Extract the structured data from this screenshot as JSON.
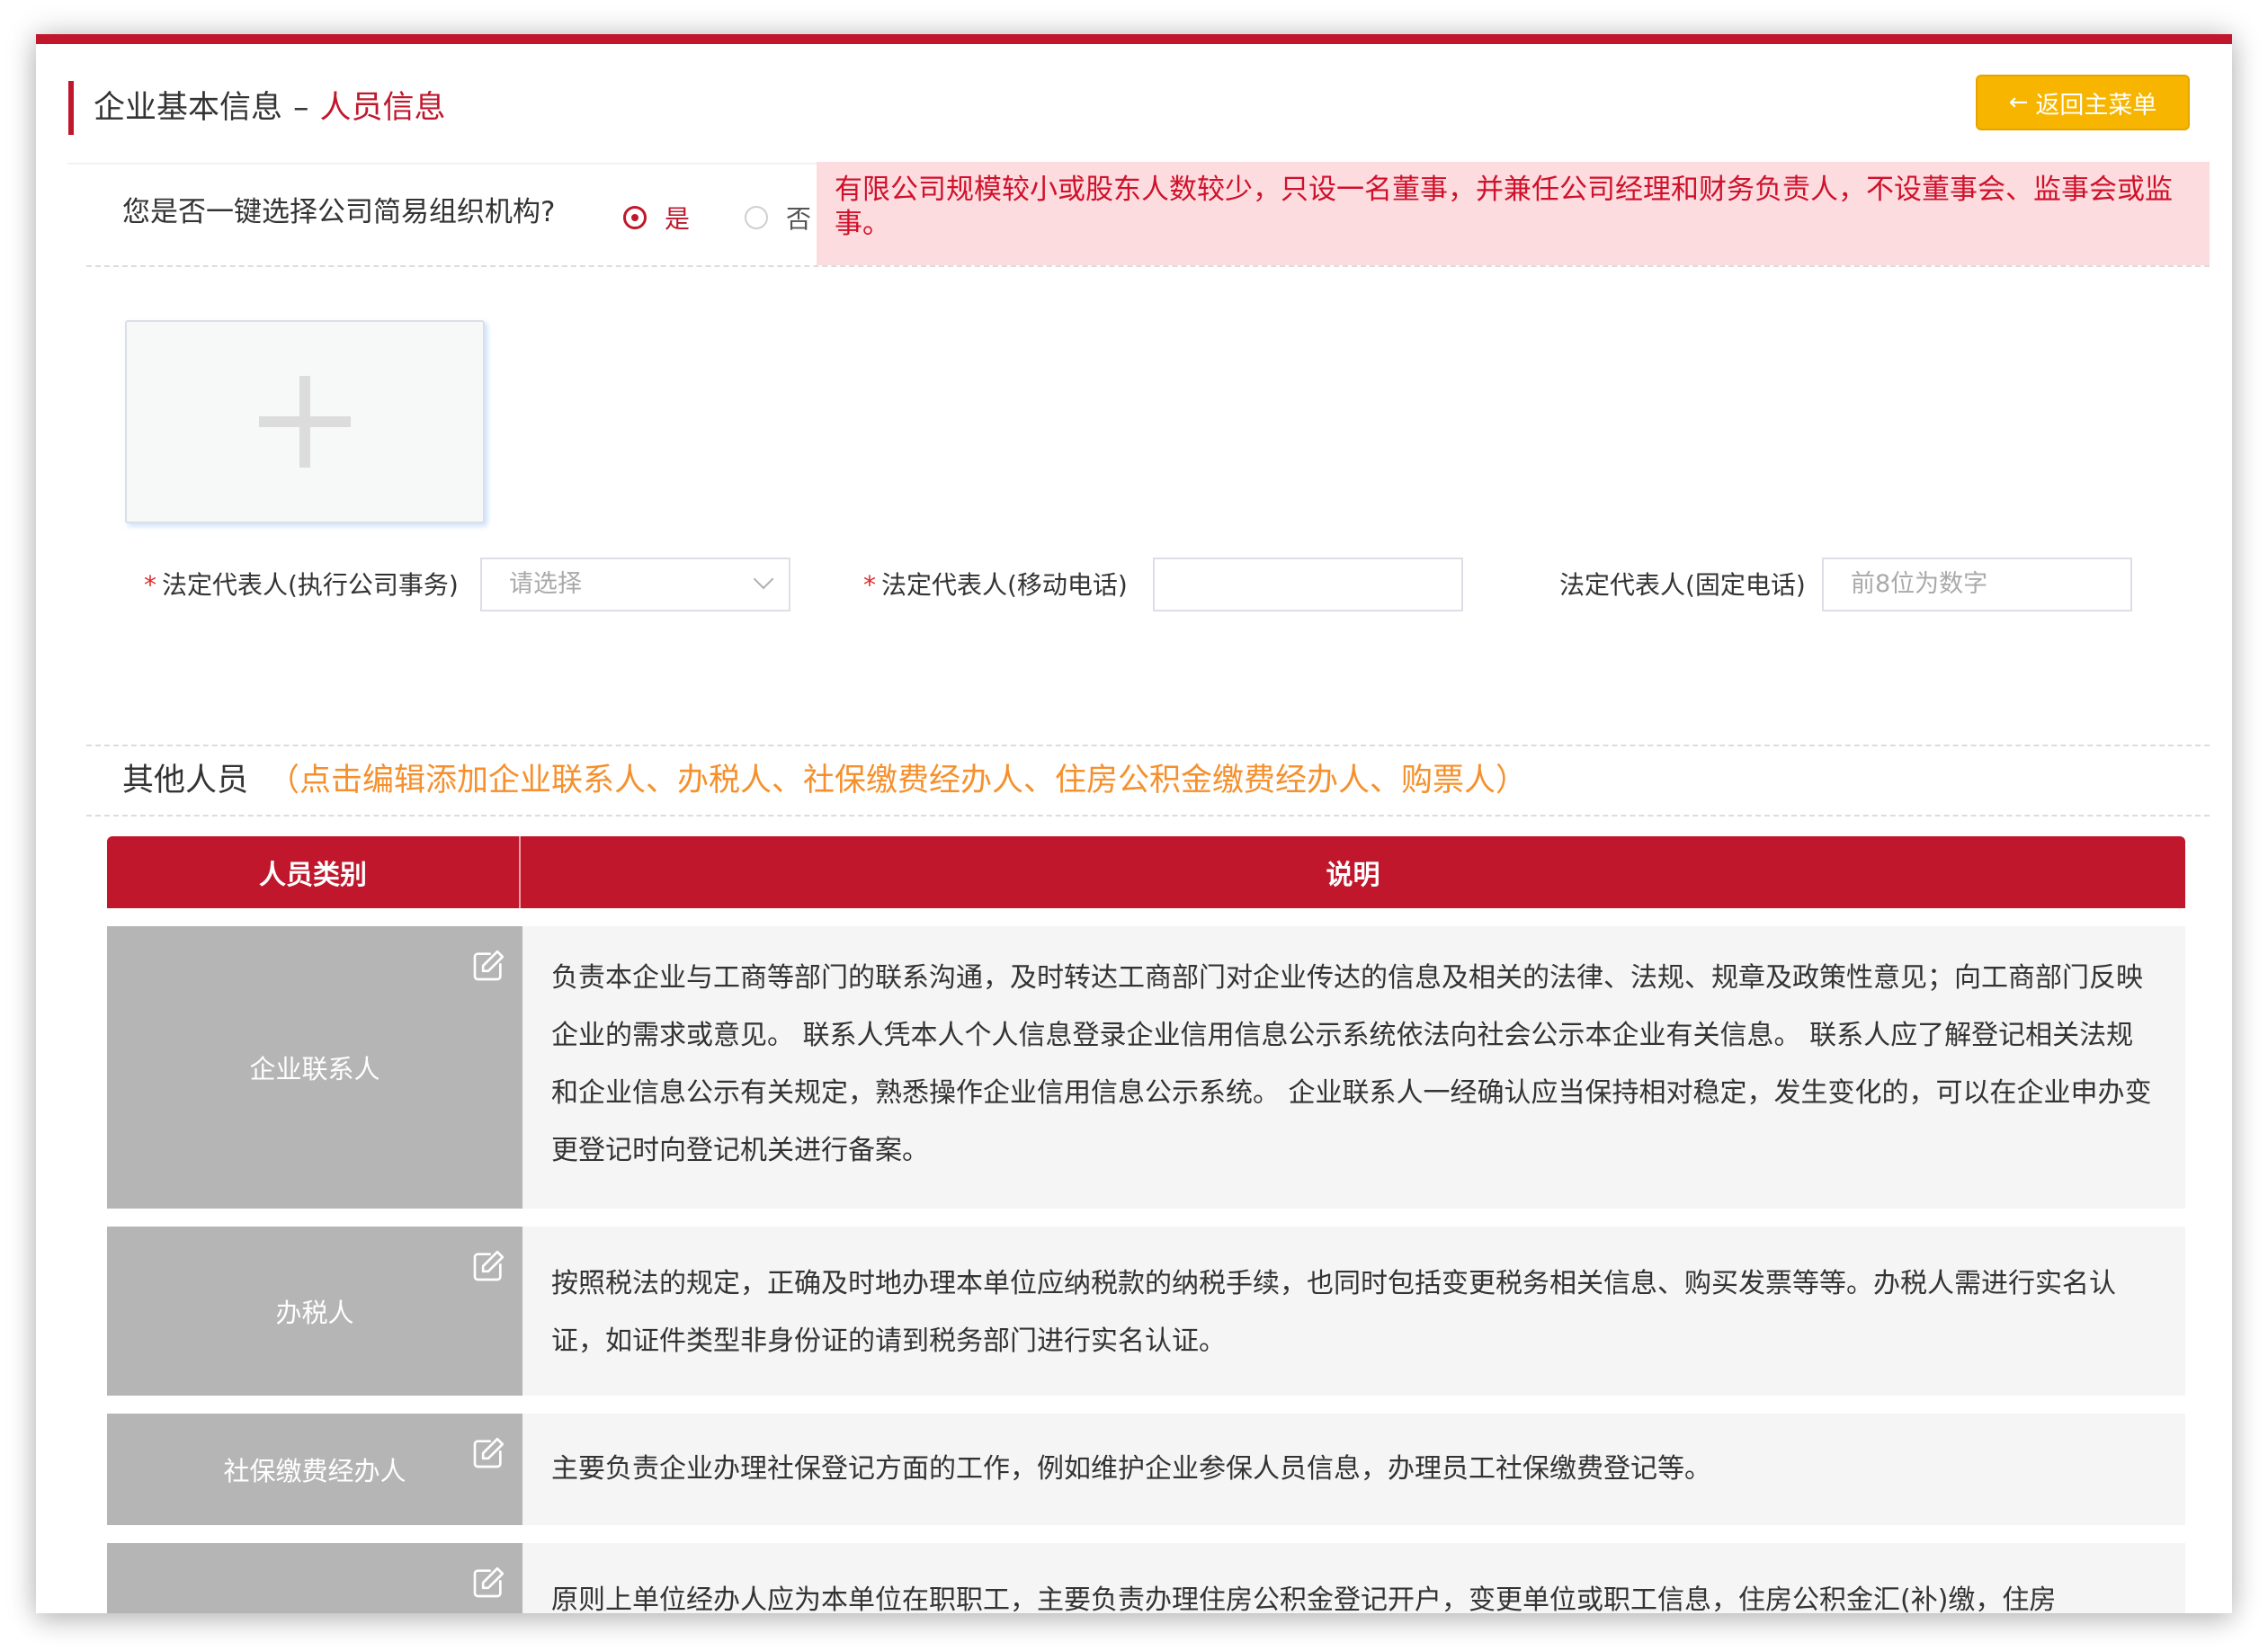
{
  "header": {
    "title_main": "企业基本信息",
    "title_separator": "–",
    "title_sub": "人员信息",
    "back_button_icon": "arrow-left-icon",
    "back_button_label": "返回主菜单"
  },
  "simple_org": {
    "question": "您是否一键选择公司简易组织机构?",
    "options": [
      {
        "label": "是",
        "selected": true
      },
      {
        "label": "否",
        "selected": false
      }
    ],
    "notice": "有限公司规模较小或股东人数较少，只设一名董事，并兼任公司经理和财务负责人，不设董事会、监事会或监事。"
  },
  "upload": {
    "icon": "plus-icon"
  },
  "form": {
    "legal_rep_label": "法定代表人(执行公司事务)",
    "legal_rep_placeholder": "请选择",
    "mobile_label": "法定代表人(移动电话)",
    "mobile_value": "",
    "landline_label": "法定代表人(固定电话)",
    "landline_placeholder": "前8位为数字",
    "required_mark": "*"
  },
  "others": {
    "title": "其他人员",
    "hint": "（点击编辑添加企业联系人、办税人、社保缴费经办人、住房公积金缴费经办人、购票人）"
  },
  "table": {
    "headers": [
      "人员类别",
      "说明"
    ],
    "rows": [
      {
        "category": "企业联系人",
        "description": "负责本企业与工商等部门的联系沟通，及时转达工商部门对企业传达的信息及相关的法律、法规、规章及政策性意见；向工商部门反映企业的需求或意见。 联系人凭本人个人信息登录企业信用信息公示系统依法向社会公示本企业有关信息。 联系人应了解登记相关法规和企业信息公示有关规定，熟悉操作企业信用信息公示系统。 企业联系人一经确认应当保持相对稳定，发生变化的，可以在企业申办变更登记时向登记机关进行备案。"
      },
      {
        "category": "办税人",
        "description": "按照税法的规定，正确及时地办理本单位应纳税款的纳税手续，也同时包括变更税务相关信息、购买发票等等。办税人需进行实名认证，如证件类型非身份证的请到税务部门进行实名认证。"
      },
      {
        "category": "社保缴费经办人",
        "description": "主要负责企业办理社保登记方面的工作，例如维护企业参保人员信息，办理员工社保缴费登记等。"
      },
      {
        "category": "",
        "description": "原则上单位经办人应为本单位在职职工，主要负责办理住房公积金登记开户，变更单位或职工信息，住房公积金汇(补)缴，住房"
      }
    ],
    "edit_icon": "edit-icon"
  },
  "colors": {
    "primary": "#c0172c",
    "button": "#f7b500",
    "notice_bg": "#fcdcdf",
    "hint": "#f5902d",
    "category_bg": "#b5b5b5"
  }
}
